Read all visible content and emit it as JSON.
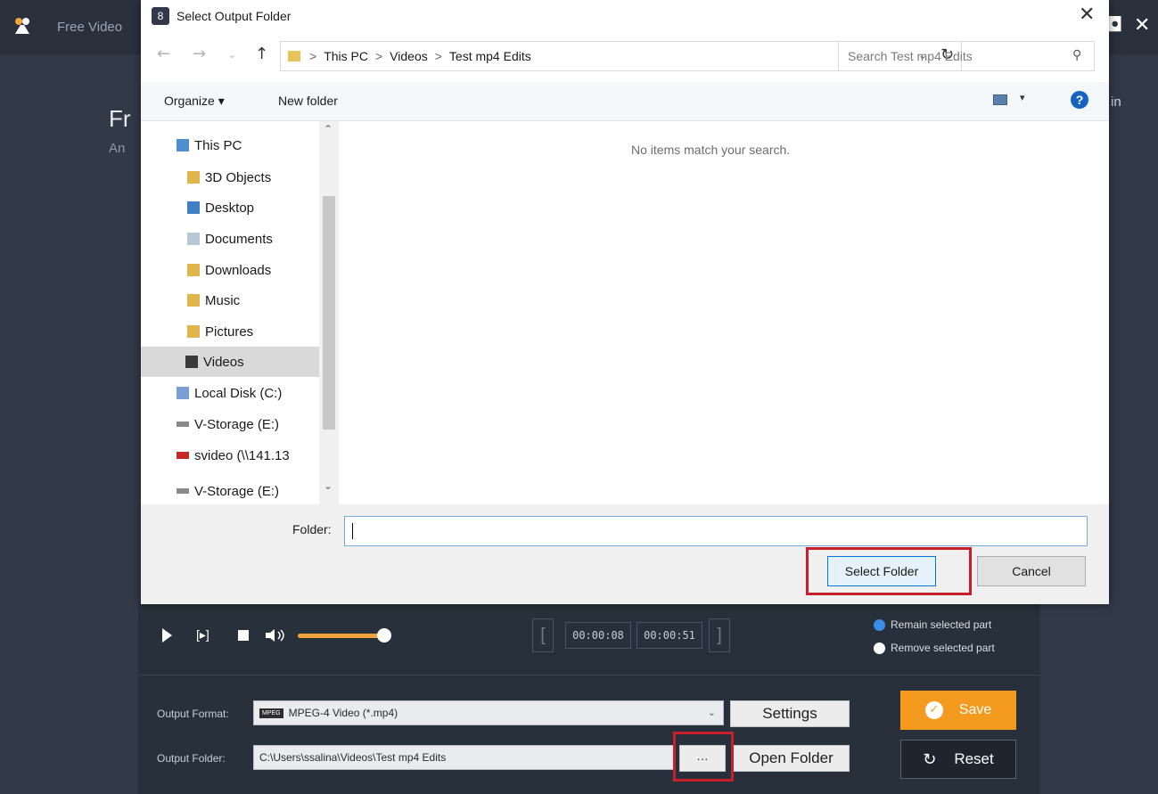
{
  "app": {
    "title": "Free Video",
    "heading": "Fr",
    "subheading": "An",
    "login": "in",
    "min_icon": "minimize-icon",
    "close_icon": "close-icon"
  },
  "dialog": {
    "title": "Select Output Folder",
    "breadcrumb": [
      "This PC",
      "Videos",
      "Test mp4 Edits"
    ],
    "breadcrumb_sep": ">",
    "search_placeholder": "Search Test mp4 Edits",
    "toolbar": {
      "organize": "Organize ▾",
      "new_folder": "New folder",
      "help": "?"
    },
    "tree": [
      {
        "label": "This PC",
        "icon": "computer-icon",
        "color": "#4f8fd0"
      },
      {
        "label": "3D Objects",
        "icon": "cube-icon",
        "color": "#e0b54c"
      },
      {
        "label": "Desktop",
        "icon": "desktop-icon",
        "color": "#3f7fc4"
      },
      {
        "label": "Documents",
        "icon": "documents-icon",
        "color": "#b9c6d6"
      },
      {
        "label": "Downloads",
        "icon": "download-icon",
        "color": "#e0b54c"
      },
      {
        "label": "Music",
        "icon": "music-icon",
        "color": "#e0b54c"
      },
      {
        "label": "Pictures",
        "icon": "pictures-icon",
        "color": "#e0b54c"
      },
      {
        "label": "Videos",
        "icon": "video-icon",
        "color": "#3a3a3a"
      },
      {
        "label": "Local Disk (C:)",
        "icon": "disk-icon",
        "color": "#7a9fd1"
      },
      {
        "label": "V-Storage (E:)",
        "icon": "drive-icon",
        "color": "#8a8a8a"
      },
      {
        "label": "svideo (\\\\141.13",
        "icon": "network-drive-disconnected-icon",
        "color": "#c62828"
      },
      {
        "label": "V-Storage (E:)",
        "icon": "drive-icon",
        "color": "#8a8a8a"
      }
    ],
    "empty_message": "No items match your search.",
    "folder_label": "Folder:",
    "folder_value": "",
    "select_button": "Select Folder",
    "cancel_button": "Cancel"
  },
  "player": {
    "time_start": "00:00:08",
    "time_end": "00:00:51",
    "volume_level": 0.9,
    "options": [
      {
        "label": "Remain selected part",
        "selected": true
      },
      {
        "label": "Remove selected part",
        "selected": false
      }
    ]
  },
  "output": {
    "format_label": "Output Format:",
    "format_value": "MPEG-4 Video (*.mp4)",
    "format_badge": "MPEG",
    "settings_button": "Settings",
    "folder_label": "Output Folder:",
    "folder_value": "C:\\Users\\ssalina\\Videos\\Test mp4 Edits",
    "browse_button": "···",
    "open_folder_button": "Open Folder",
    "save_button": "Save",
    "reset_button": "Reset"
  },
  "colors": {
    "accent": "#f39a1f",
    "highlight_box": "#c8202a",
    "radio_selected": "#3a8ee6"
  }
}
